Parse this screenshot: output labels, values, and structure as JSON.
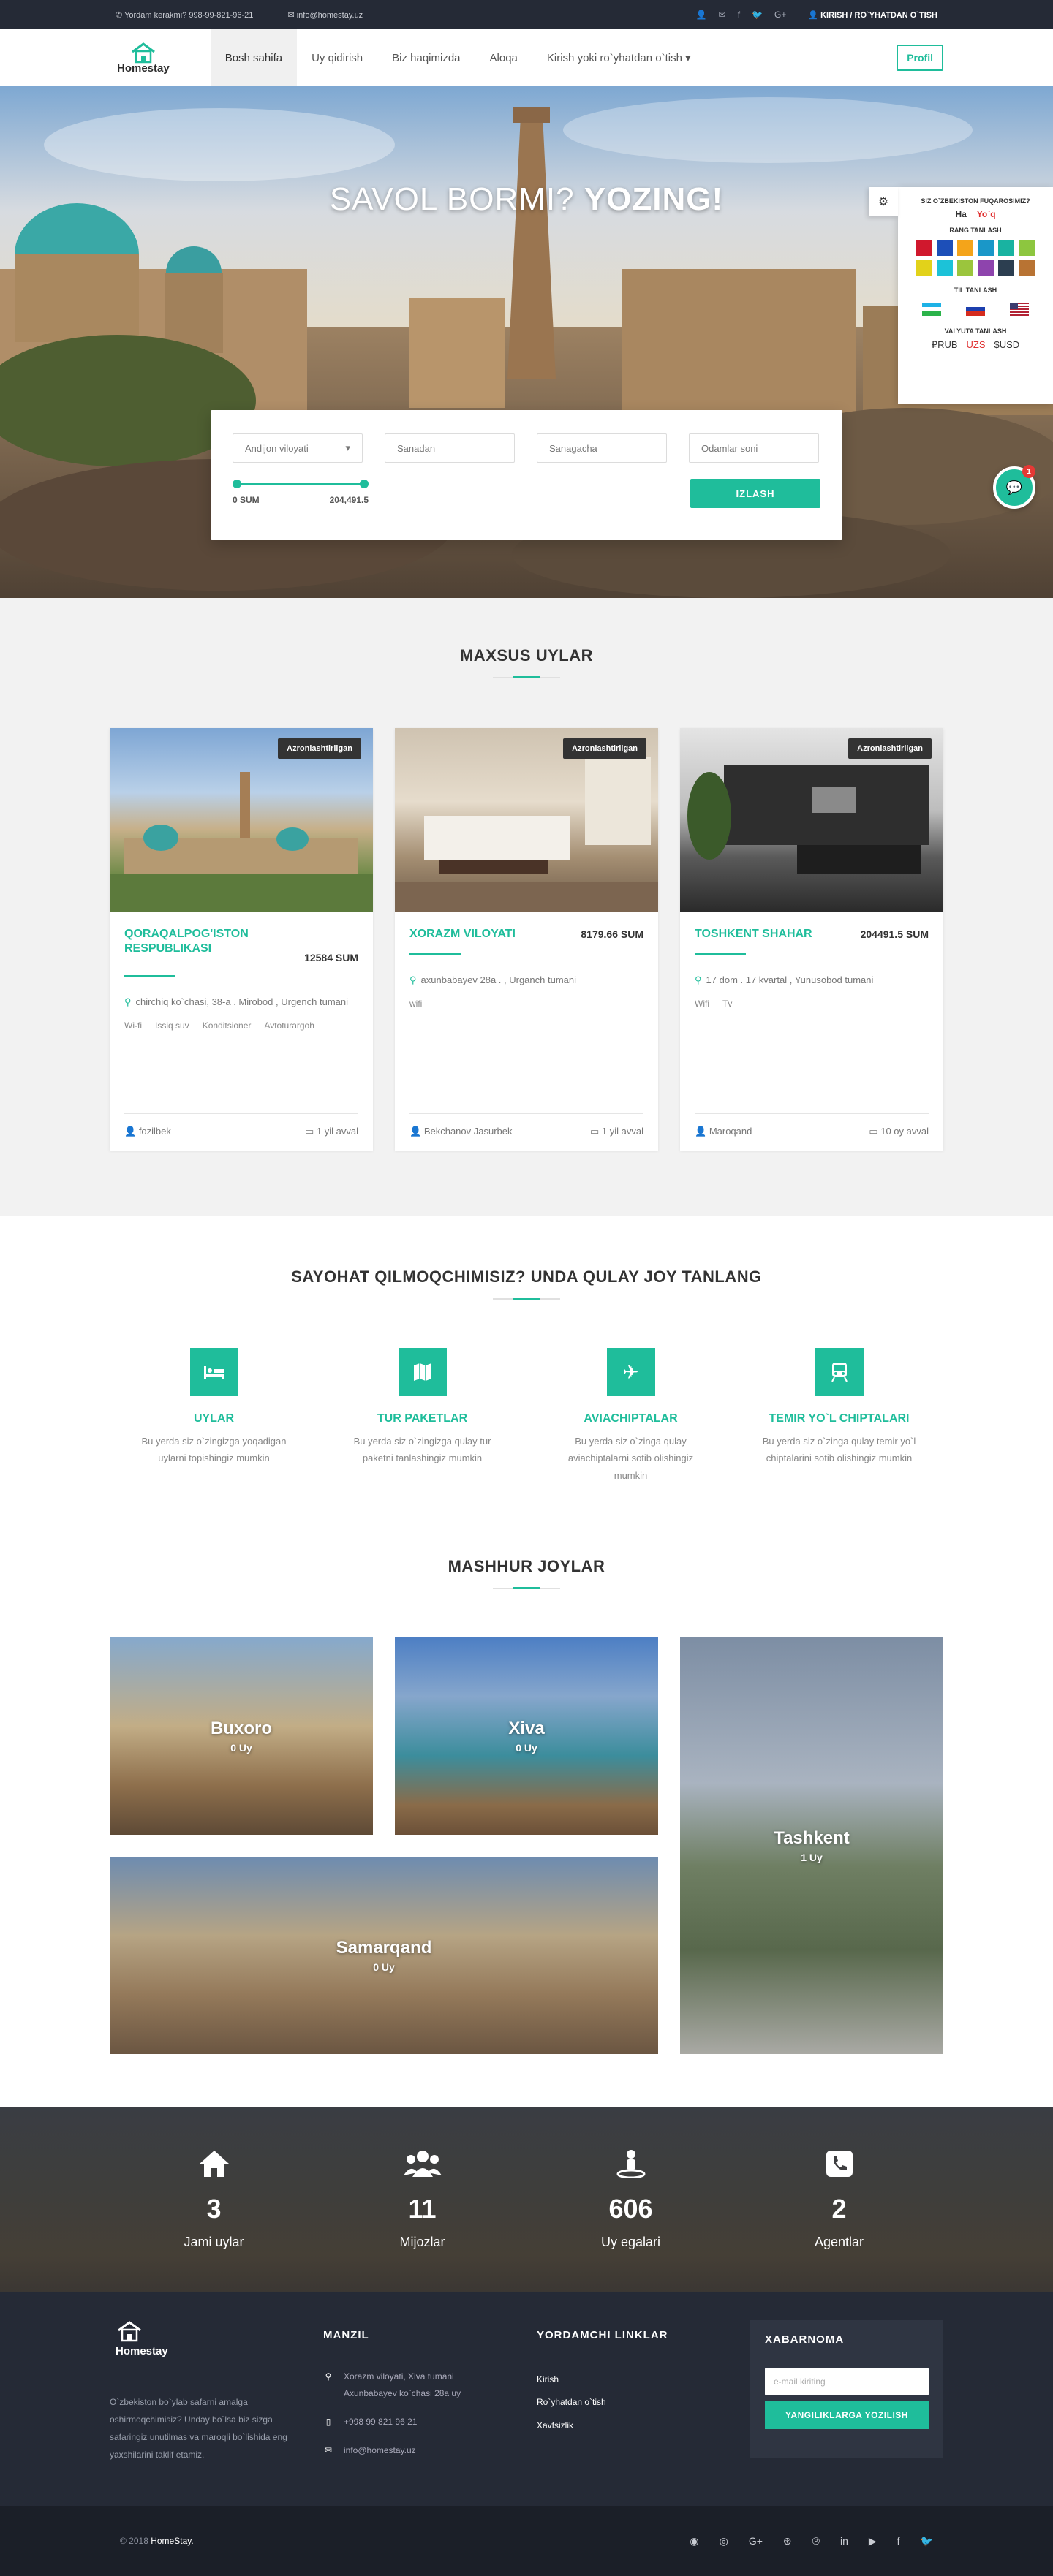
{
  "topbar": {
    "help": "Yordam kerakmi? 998-99-821-96-21",
    "email": "info@homestay.uz",
    "auth": "KIRISH / RO`YHATDAN O`TISH"
  },
  "nav": {
    "logo": "Homestay",
    "items": [
      "Bosh sahifa",
      "Uy qidirish",
      "Biz haqimizda",
      "Aloqa",
      "Kirish yoki ro`yhatdan o`tish"
    ],
    "profile": "Profil"
  },
  "hero": {
    "title_a": "SAVOL BORMI?",
    "title_b": "YOZING!"
  },
  "search": {
    "region": "Andijon viloyati",
    "from_ph": "Sanadan",
    "to_ph": "Sanagacha",
    "people_ph": "Odamlar soni",
    "min": "0 SUM",
    "max": "204,491.5",
    "button": "IZLASH"
  },
  "panel": {
    "q": "SIZ O`ZBEKISTON FUQAROSIMIZ?",
    "yes": "Ha",
    "no": "Yo`q",
    "color_title": "RANG TANLASH",
    "lang_title": "TIL TANLASH",
    "cur_title": "VALYUTA TANLASH",
    "cur": [
      "₽RUB",
      "UZS",
      "$USD"
    ],
    "swatches": [
      "#d0182d",
      "#1d4fb8",
      "#f4a41a",
      "#1a97c8",
      "#19b3a1",
      "#8dc63f",
      "#e2d21a",
      "#1cc2d8",
      "#9bc53d",
      "#8e44ad",
      "#2c3e50",
      "#b87333"
    ]
  },
  "chat": {
    "badge": "1",
    "icon": "chat-icon"
  },
  "special": {
    "title": "MAXSUS UYLAR",
    "cards": [
      {
        "badge": "Azronlashtirilgan",
        "name": "QORAQALPOG'ISTON RESPUBLIKASI",
        "price": "12584 SUM",
        "addr": "chirchiq ko`chasi, 38-a . Mirobod , Urgench tumani",
        "features": [
          "Wi-fi",
          "Issiq suv",
          "Konditsioner",
          "Avtoturargoh"
        ],
        "owner": "fozilbek",
        "time": "1 yil avval"
      },
      {
        "badge": "Azronlashtirilgan",
        "name": "XORAZM VILOYATI",
        "price": "8179.66 SUM",
        "addr": "axunbabayev 28a . , Urganch tumani",
        "features": [
          "wifi"
        ],
        "owner": "Bekchanov Jasurbek",
        "time": "1 yil avval"
      },
      {
        "badge": "Azronlashtirilgan",
        "name": "TOSHKENT SHAHAR",
        "price": "204491.5 SUM",
        "addr": "17 dom . 17 kvartal , Yunusobod tumani",
        "features": [
          "Wifi",
          "Tv"
        ],
        "owner": "Maroqand",
        "time": "10 oy avval"
      }
    ]
  },
  "services": {
    "title": "SAYOHAT QILMOQCHIMISIZ? UNDA QULAY JOY TANLANG",
    "items": [
      {
        "title": "UYLAR",
        "text": "Bu yerda siz o`zingizga yoqadigan uylarni topishingiz mumkin",
        "icon": "bed-icon"
      },
      {
        "title": "TUR PAKETLAR",
        "text": "Bu yerda siz o`zingizga qulay tur paketni tanlashingiz mumkin",
        "icon": "map-icon"
      },
      {
        "title": "AVIACHIPTALAR",
        "text": "Bu yerda siz o`zinga qulay aviachiptalarni sotib olishingiz mumkin",
        "icon": "plane-icon"
      },
      {
        "title": "TEMIR YO`L CHIPTALARI",
        "text": "Bu yerda siz o`zinga qulay temir yo`l chiptalarini sotib olishingiz mumkin",
        "icon": "train-icon"
      }
    ]
  },
  "places": {
    "title": "MASHHUR JOYLAR",
    "items": [
      {
        "name": "Buxoro",
        "count": "0 Uy"
      },
      {
        "name": "Xiva",
        "count": "0 Uy"
      },
      {
        "name": "Tashkent",
        "count": "1 Uy"
      },
      {
        "name": "Samarqand",
        "count": "0 Uy"
      }
    ]
  },
  "stats": [
    {
      "n": "3",
      "l": "Jami uylar",
      "icon": "home-icon"
    },
    {
      "n": "11",
      "l": "Mijozlar",
      "icon": "users-icon"
    },
    {
      "n": "606",
      "l": "Uy egalari",
      "icon": "owner-icon"
    },
    {
      "n": "2",
      "l": "Agentlar",
      "icon": "phone-icon"
    }
  ],
  "footer": {
    "logo": "Homestay",
    "about": "O`zbekiston bo`ylab safarni amalga oshirmoqchimisiz? Unday bo`lsa biz sizga safaringiz unutilmas va maroqli bo`lishida eng yaxshilarini taklif etamiz.",
    "addr_title": "MANZIL",
    "address": "Xorazm viloyati, Xiva tumani Axunbabayev ko`chasi 28a uy",
    "phone": "+998 99 821 96 21",
    "email": "info@homestay.uz",
    "links_title": "YORDAMCHI LINKLAR",
    "links": [
      "Kirish",
      "Ro`yhatdan o`tish",
      "Xavfsizlik"
    ],
    "news_title": "XABARNOMA",
    "news_ph": "e-mail kiriting",
    "news_btn": "YANGILIKLARGA YOZILISH",
    "copy_a": "© 2018",
    "copy_b": "HomeStay."
  }
}
